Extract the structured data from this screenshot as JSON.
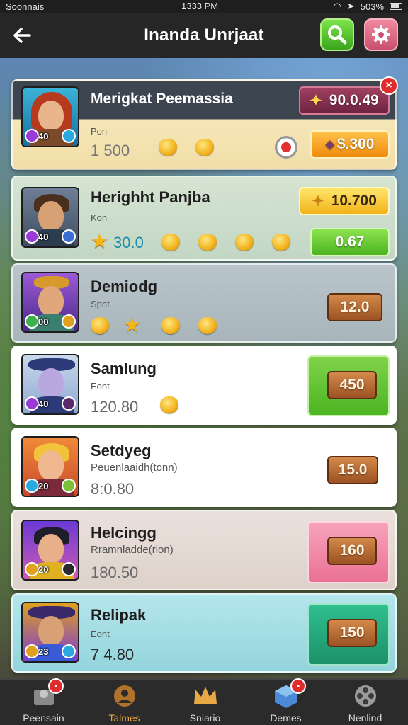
{
  "status_bar": {
    "carrier": "Soonnais",
    "time": "1333 PM",
    "battery": "503%"
  },
  "header": {
    "title": "Inanda Unrjaat"
  },
  "rows": [
    {
      "name": "Merigkat Peemassia",
      "sub": "Pon",
      "stat": "1   500",
      "level": "40",
      "price_top": "90.0.49",
      "price_bottom": "$.300",
      "notif": "×"
    },
    {
      "name": "Herighht Panjba",
      "sub": "Kon",
      "stat": "30.0",
      "level": "40",
      "price_top": "10.700",
      "price_bottom": "0.67"
    },
    {
      "name": "Demiodg",
      "sub": "Spnt",
      "stat": "",
      "level": "00",
      "price": "12.0"
    },
    {
      "name": "Samlung",
      "sub": "Eont",
      "stat": "120.80",
      "level": "40",
      "price": "450"
    },
    {
      "name": "Setdyeg",
      "sub": "Peuenlaaidh(tonn)",
      "stat": "8:0.80",
      "level": "20",
      "price": "15.0"
    },
    {
      "name": "Helcingg",
      "sub": "Rramnladde(rion)",
      "stat": "180.50",
      "level": "20",
      "price": "160"
    },
    {
      "name": "Relipak",
      "sub": "Eont",
      "stat": "7  4.80",
      "level": "23",
      "price": "150"
    }
  ],
  "bottom_nav": [
    {
      "label": "Peensain",
      "active": false
    },
    {
      "label": "Talmes",
      "active": true
    },
    {
      "label": "Sniario",
      "active": false
    },
    {
      "label": "Demes",
      "active": false
    },
    {
      "label": "Nenlind",
      "active": false
    }
  ],
  "colors": {
    "row1_bg": "#f6e7b8",
    "row2_bg": "#cfe0cf",
    "row3_bg": "#b7c3c8",
    "row4_bg": "#ffffff",
    "row5_bg": "#ffffff",
    "row6_bg": "#e7dcd6",
    "row7_bg": "#a8e0e6",
    "green_button": "#5cc228",
    "pink_button": "#f08ba8",
    "teal_button": "#24a67d",
    "gold_button": "#f5a623"
  }
}
